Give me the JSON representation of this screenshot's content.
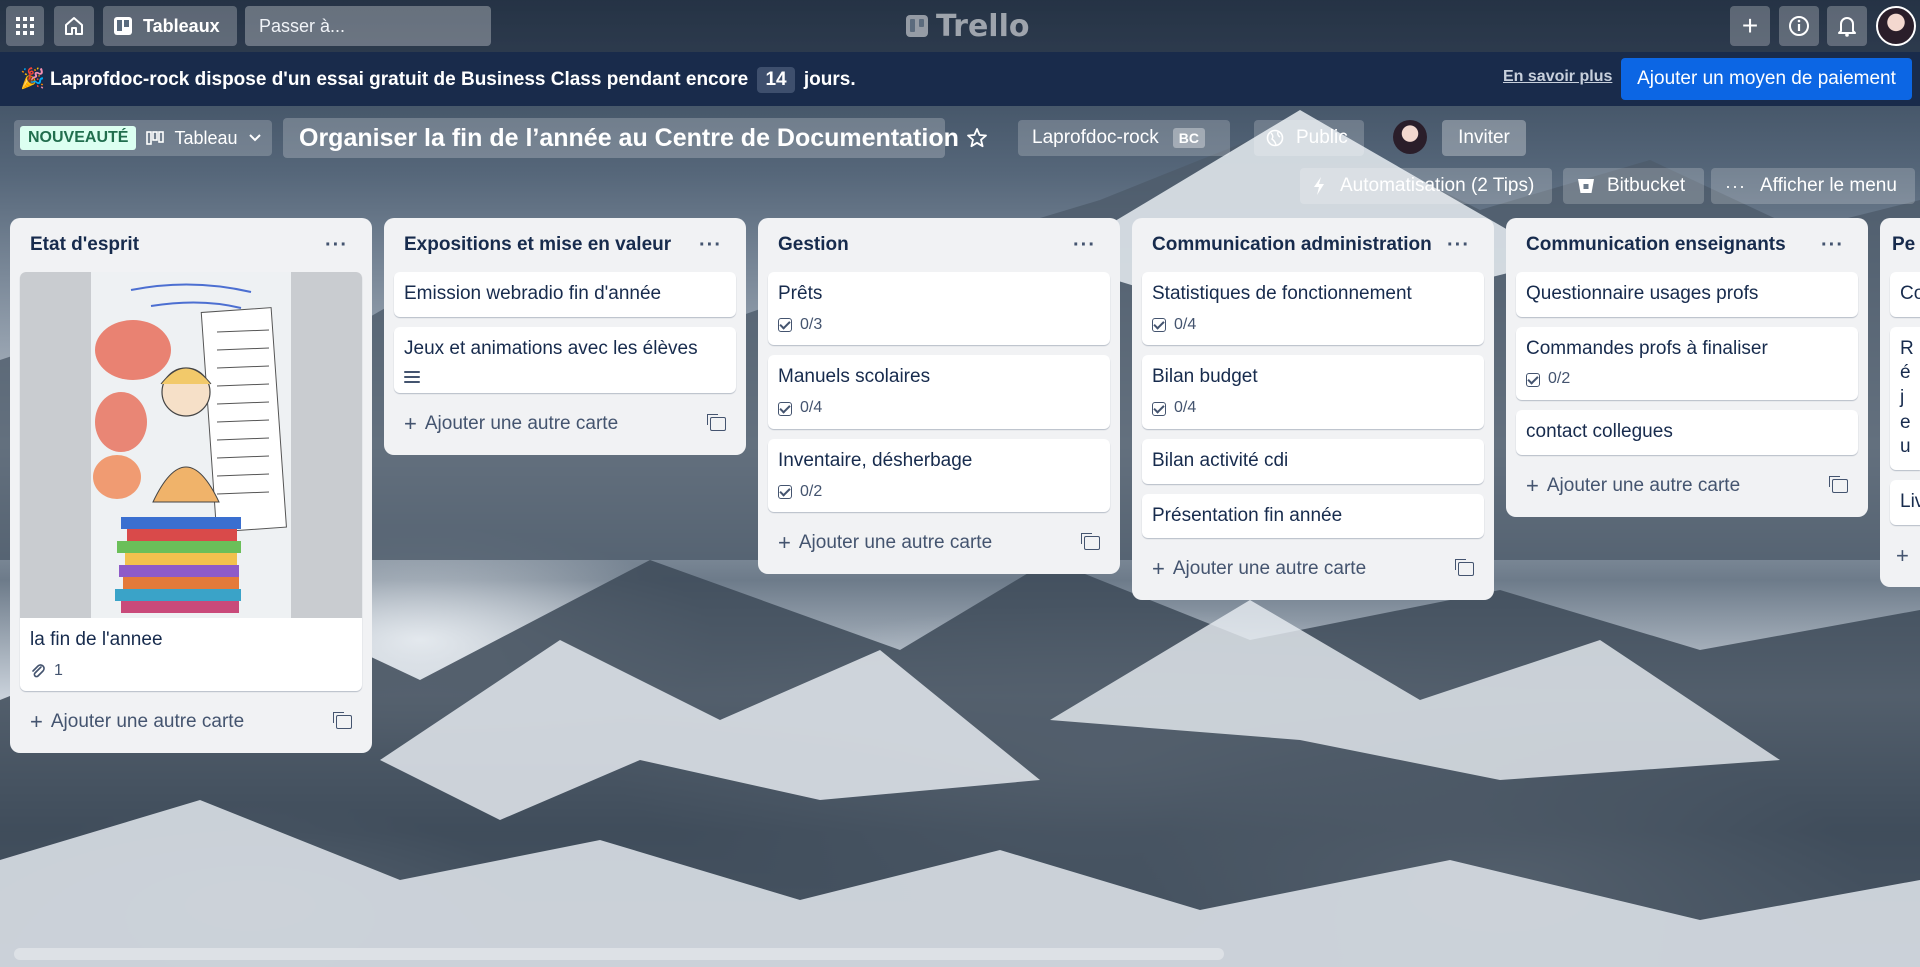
{
  "topbar": {
    "boards_label": "Tableaux",
    "search_placeholder": "Passer à...",
    "logo_text": "Trello"
  },
  "banner": {
    "message_before": "Laprofdoc-rock dispose d'un essai gratuit de Business Class pendant encore",
    "days": "14",
    "message_after": "jours.",
    "learn_more": "En savoir plus",
    "pay_button": "Ajouter un moyen de paiement"
  },
  "board": {
    "new_badge": "NOUVEAUTÉ",
    "view_label": "Tableau",
    "title": "Organiser la fin de l’année au Centre de Documentation",
    "workspace": "Laprofdoc-rock",
    "workspace_badge": "BC",
    "visibility": "Public",
    "invite": "Inviter",
    "automation": "Automatisation (2 Tips)",
    "bitbucket": "Bitbucket",
    "menu": "Afficher le menu"
  },
  "add_card_label": "Ajouter une autre carte",
  "lists": [
    {
      "title": "Etat d'esprit",
      "cards": [
        {
          "title": "la fin de l'annee",
          "attachments": "1"
        }
      ]
    },
    {
      "title": "Expositions et mise en valeur",
      "cards": [
        {
          "title": "Emission webradio fin d'année"
        },
        {
          "title": "Jeux et animations avec les élèves"
        }
      ]
    },
    {
      "title": "Gestion",
      "cards": [
        {
          "title": "Prêts",
          "checklist": "0/3"
        },
        {
          "title": "Manuels scolaires",
          "checklist": "0/4"
        },
        {
          "title": "Inventaire, désherbage",
          "checklist": "0/2"
        }
      ]
    },
    {
      "title": "Communication administration",
      "cards": [
        {
          "title": "Statistiques de fonctionnement",
          "checklist": "0/4"
        },
        {
          "title": "Bilan budget",
          "checklist": "0/4"
        },
        {
          "title": "Bilan activité cdi"
        },
        {
          "title": "Présentation fin année"
        }
      ]
    },
    {
      "title": "Communication enseignants",
      "cards": [
        {
          "title": "Questionnaire usages profs"
        },
        {
          "title": "Commandes profs à finaliser",
          "checklist": "0/2"
        },
        {
          "title": "contact collegues"
        }
      ]
    },
    {
      "title": "Pe",
      "cards": [
        {
          "title": "Co"
        },
        {
          "title": "Ré jeu"
        },
        {
          "title": "Liv"
        }
      ]
    }
  ],
  "colors": {
    "banner_bg": "#192b4b",
    "pay_button_bg": "#0c66e4",
    "list_bg": "#f1f2f4",
    "new_badge_bg": "#dcfff1"
  }
}
